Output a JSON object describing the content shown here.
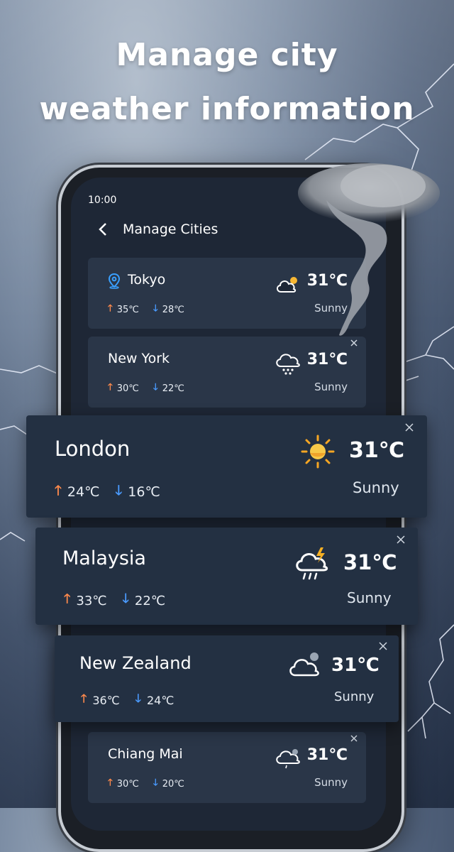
{
  "headline": {
    "line1": "Manage city",
    "line2": "weather information"
  },
  "status_bar": {
    "time": "10:00"
  },
  "header": {
    "title": "Manage Cities"
  },
  "cities": [
    {
      "name": "Tokyo",
      "high": "35℃",
      "low": "28℃",
      "temp": "31℃",
      "condition": "Sunny",
      "icon": "partly-cloudy-icon",
      "current_location": true
    },
    {
      "name": "New York",
      "high": "30℃",
      "low": "22℃",
      "temp": "31℃",
      "condition": "Sunny",
      "icon": "rain-icon"
    },
    {
      "name": "London",
      "high": "24℃",
      "low": "16℃",
      "temp": "31℃",
      "condition": "Sunny",
      "icon": "sun-icon"
    },
    {
      "name": "Malaysia",
      "high": "33℃",
      "low": "22℃",
      "temp": "31℃",
      "condition": "Sunny",
      "icon": "thunderstorm-icon"
    },
    {
      "name": "New Zealand",
      "high": "36℃",
      "low": "24℃",
      "temp": "31℃",
      "condition": "Sunny",
      "icon": "cloudy-icon"
    },
    {
      "name": "Chiang Mai",
      "high": "30℃",
      "low": "20℃",
      "temp": "31℃",
      "condition": "Sunny",
      "icon": "cloudy-rain-icon"
    }
  ],
  "arrows": {
    "up": "🡑",
    "down": "🡓"
  },
  "colors": {
    "card": "#2a3648",
    "card_large": "#233042",
    "high_arrow": "#ff8a4c",
    "low_arrow": "#4a9bff",
    "location_pin": "#3aa0ff"
  }
}
